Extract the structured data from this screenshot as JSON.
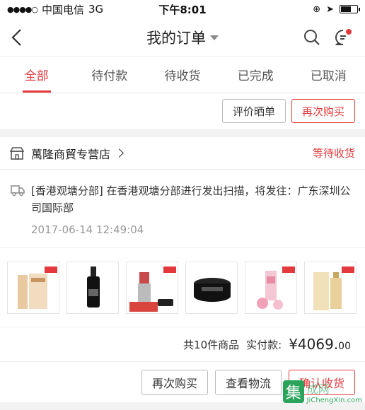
{
  "status_bar": {
    "carrier": "中国电信",
    "network": "3G",
    "time": "下午8:01"
  },
  "nav": {
    "title": "我的订单"
  },
  "tabs": [
    {
      "label": "全部"
    },
    {
      "label": "待付款"
    },
    {
      "label": "待收货"
    },
    {
      "label": "已完成"
    },
    {
      "label": "已取消"
    }
  ],
  "prev_order": {
    "review_label": "评价晒单",
    "rebuy_label": "再次购买"
  },
  "order": {
    "shop_name": "萬隆商貿专营店",
    "status": "等待收货",
    "logistics_text": "[香港观塘分部] 在香港观塘分部进行发出扫描，将发往：广东深圳公司国际部",
    "logistics_time": "2017-06-14 12:49:04",
    "summary_count": "共10件商品",
    "summary_paid_label": "实付款:",
    "price_main": "¥4069.",
    "price_cents": "00",
    "rebuy_label": "再次购买",
    "logistics_label": "查看物流",
    "confirm_label": "确认收货"
  },
  "watermark": {
    "char": "集",
    "name": "成网",
    "url": "JiChengXin.com"
  },
  "colors": {
    "accent": "#e4393c",
    "watermark": "#2ba45b"
  }
}
